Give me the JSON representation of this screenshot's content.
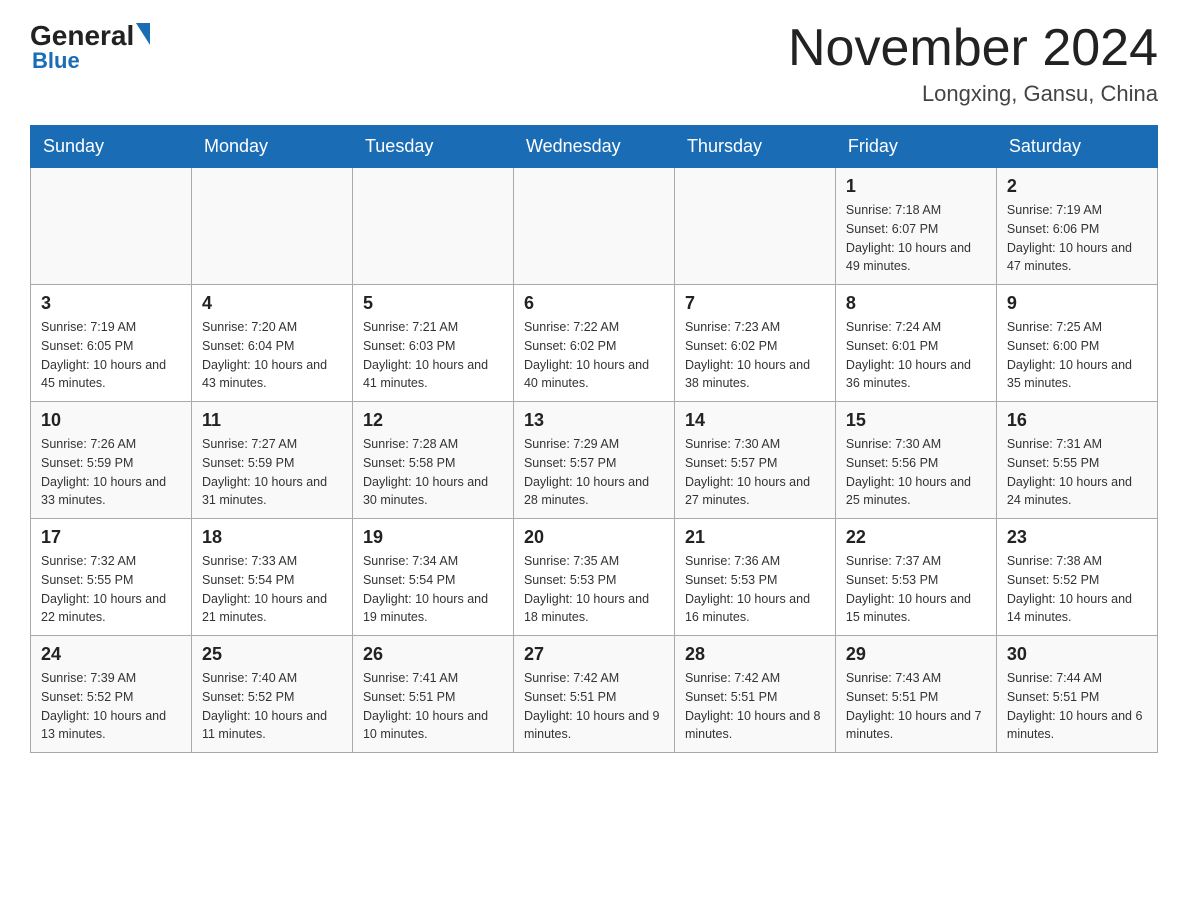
{
  "header": {
    "logo_general": "General",
    "logo_blue": "Blue",
    "month_year": "November 2024",
    "location": "Longxing, Gansu, China"
  },
  "weekdays": [
    "Sunday",
    "Monday",
    "Tuesday",
    "Wednesday",
    "Thursday",
    "Friday",
    "Saturday"
  ],
  "weeks": [
    [
      {
        "day": "",
        "info": ""
      },
      {
        "day": "",
        "info": ""
      },
      {
        "day": "",
        "info": ""
      },
      {
        "day": "",
        "info": ""
      },
      {
        "day": "",
        "info": ""
      },
      {
        "day": "1",
        "info": "Sunrise: 7:18 AM\nSunset: 6:07 PM\nDaylight: 10 hours\nand 49 minutes."
      },
      {
        "day": "2",
        "info": "Sunrise: 7:19 AM\nSunset: 6:06 PM\nDaylight: 10 hours\nand 47 minutes."
      }
    ],
    [
      {
        "day": "3",
        "info": "Sunrise: 7:19 AM\nSunset: 6:05 PM\nDaylight: 10 hours\nand 45 minutes."
      },
      {
        "day": "4",
        "info": "Sunrise: 7:20 AM\nSunset: 6:04 PM\nDaylight: 10 hours\nand 43 minutes."
      },
      {
        "day": "5",
        "info": "Sunrise: 7:21 AM\nSunset: 6:03 PM\nDaylight: 10 hours\nand 41 minutes."
      },
      {
        "day": "6",
        "info": "Sunrise: 7:22 AM\nSunset: 6:02 PM\nDaylight: 10 hours\nand 40 minutes."
      },
      {
        "day": "7",
        "info": "Sunrise: 7:23 AM\nSunset: 6:02 PM\nDaylight: 10 hours\nand 38 minutes."
      },
      {
        "day": "8",
        "info": "Sunrise: 7:24 AM\nSunset: 6:01 PM\nDaylight: 10 hours\nand 36 minutes."
      },
      {
        "day": "9",
        "info": "Sunrise: 7:25 AM\nSunset: 6:00 PM\nDaylight: 10 hours\nand 35 minutes."
      }
    ],
    [
      {
        "day": "10",
        "info": "Sunrise: 7:26 AM\nSunset: 5:59 PM\nDaylight: 10 hours\nand 33 minutes."
      },
      {
        "day": "11",
        "info": "Sunrise: 7:27 AM\nSunset: 5:59 PM\nDaylight: 10 hours\nand 31 minutes."
      },
      {
        "day": "12",
        "info": "Sunrise: 7:28 AM\nSunset: 5:58 PM\nDaylight: 10 hours\nand 30 minutes."
      },
      {
        "day": "13",
        "info": "Sunrise: 7:29 AM\nSunset: 5:57 PM\nDaylight: 10 hours\nand 28 minutes."
      },
      {
        "day": "14",
        "info": "Sunrise: 7:30 AM\nSunset: 5:57 PM\nDaylight: 10 hours\nand 27 minutes."
      },
      {
        "day": "15",
        "info": "Sunrise: 7:30 AM\nSunset: 5:56 PM\nDaylight: 10 hours\nand 25 minutes."
      },
      {
        "day": "16",
        "info": "Sunrise: 7:31 AM\nSunset: 5:55 PM\nDaylight: 10 hours\nand 24 minutes."
      }
    ],
    [
      {
        "day": "17",
        "info": "Sunrise: 7:32 AM\nSunset: 5:55 PM\nDaylight: 10 hours\nand 22 minutes."
      },
      {
        "day": "18",
        "info": "Sunrise: 7:33 AM\nSunset: 5:54 PM\nDaylight: 10 hours\nand 21 minutes."
      },
      {
        "day": "19",
        "info": "Sunrise: 7:34 AM\nSunset: 5:54 PM\nDaylight: 10 hours\nand 19 minutes."
      },
      {
        "day": "20",
        "info": "Sunrise: 7:35 AM\nSunset: 5:53 PM\nDaylight: 10 hours\nand 18 minutes."
      },
      {
        "day": "21",
        "info": "Sunrise: 7:36 AM\nSunset: 5:53 PM\nDaylight: 10 hours\nand 16 minutes."
      },
      {
        "day": "22",
        "info": "Sunrise: 7:37 AM\nSunset: 5:53 PM\nDaylight: 10 hours\nand 15 minutes."
      },
      {
        "day": "23",
        "info": "Sunrise: 7:38 AM\nSunset: 5:52 PM\nDaylight: 10 hours\nand 14 minutes."
      }
    ],
    [
      {
        "day": "24",
        "info": "Sunrise: 7:39 AM\nSunset: 5:52 PM\nDaylight: 10 hours\nand 13 minutes."
      },
      {
        "day": "25",
        "info": "Sunrise: 7:40 AM\nSunset: 5:52 PM\nDaylight: 10 hours\nand 11 minutes."
      },
      {
        "day": "26",
        "info": "Sunrise: 7:41 AM\nSunset: 5:51 PM\nDaylight: 10 hours\nand 10 minutes."
      },
      {
        "day": "27",
        "info": "Sunrise: 7:42 AM\nSunset: 5:51 PM\nDaylight: 10 hours\nand 9 minutes."
      },
      {
        "day": "28",
        "info": "Sunrise: 7:42 AM\nSunset: 5:51 PM\nDaylight: 10 hours\nand 8 minutes."
      },
      {
        "day": "29",
        "info": "Sunrise: 7:43 AM\nSunset: 5:51 PM\nDaylight: 10 hours\nand 7 minutes."
      },
      {
        "day": "30",
        "info": "Sunrise: 7:44 AM\nSunset: 5:51 PM\nDaylight: 10 hours\nand 6 minutes."
      }
    ]
  ]
}
